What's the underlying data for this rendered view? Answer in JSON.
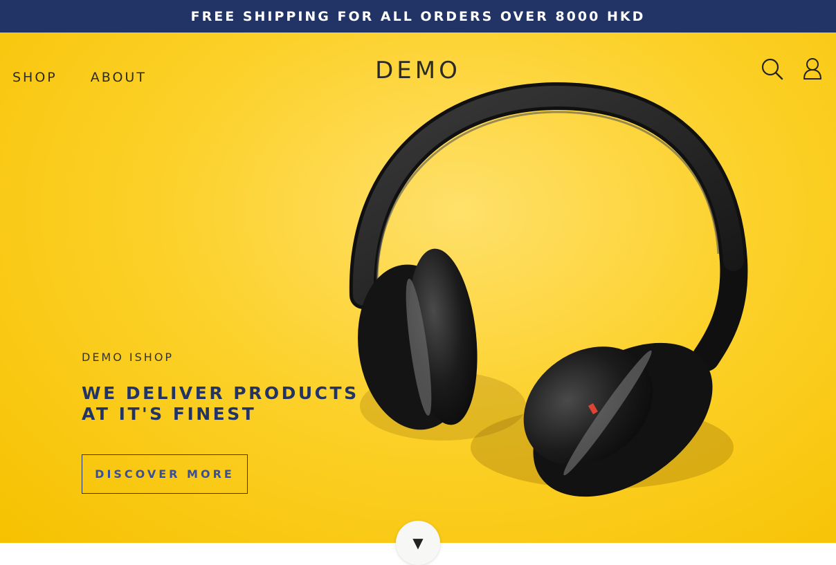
{
  "announcement": {
    "text": "FREE SHIPPING FOR ALL ORDERS OVER 8000 HKD"
  },
  "nav": {
    "shop": "SHOP",
    "about": "ABOUT"
  },
  "brand": "DEMO",
  "header_icons": {
    "search": "search-icon",
    "account": "user-icon"
  },
  "hero": {
    "eyebrow": "DEMO ISHOP",
    "headline_line1": "WE DELIVER PRODUCTS",
    "headline_line2": "AT IT'S FINEST",
    "cta_label": "DISCOVER MORE",
    "image": "headphones-on-yellow"
  },
  "scroll_button": {
    "glyph": "▼"
  },
  "colors": {
    "announcement_bg": "#223366",
    "hero_bg": "#fcd12a",
    "headline": "#223366",
    "cta_text": "#3a4f99",
    "text_dark": "#2a2a2a"
  }
}
